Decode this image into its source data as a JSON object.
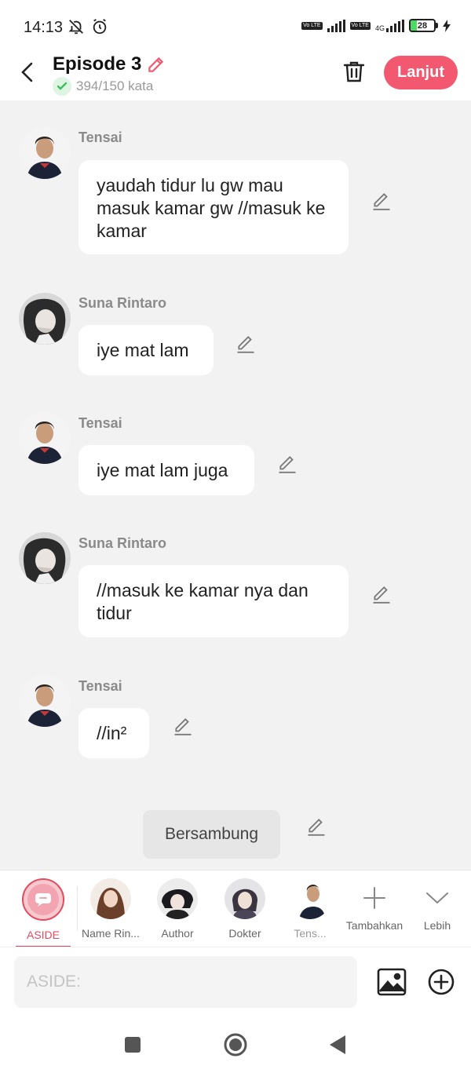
{
  "status": {
    "time": "14:13",
    "net1": "Vo LTE",
    "net2": "Vo LTE",
    "net3": "4G",
    "battery": "28",
    "battery_fraction": 0.28
  },
  "header": {
    "title": "Episode 3",
    "word_count": "394/150 kata",
    "next_label": "Lanjut",
    "accent_color": "#f2586f"
  },
  "messages": [
    {
      "sender": "Tensai",
      "text": "yaudah tidur lu gw mau masuk kamar gw //masuk ke kamar",
      "avatar": "tensai-avatar"
    },
    {
      "sender": "Suna Rintaro",
      "text": "iye mat lam",
      "avatar": "suna-avatar"
    },
    {
      "sender": "Tensai",
      "text": "iye mat lam juga",
      "avatar": "tensai-avatar"
    },
    {
      "sender": "Suna Rintaro",
      "text": "//masuk ke kamar nya dan tidur",
      "avatar": "suna-avatar"
    },
    {
      "sender": "Tensai",
      "text": "//in²",
      "avatar": "tensai-avatar"
    }
  ],
  "continued": "Bersambung",
  "characters": [
    {
      "label": "ASIDE"
    },
    {
      "label": "Name Rin..."
    },
    {
      "label": "Author"
    },
    {
      "label": "Dokter"
    },
    {
      "label": "Tens..."
    },
    {
      "label": "Tambahkan"
    },
    {
      "label": "Lebih"
    }
  ],
  "input": {
    "placeholder": "ASIDE:"
  }
}
